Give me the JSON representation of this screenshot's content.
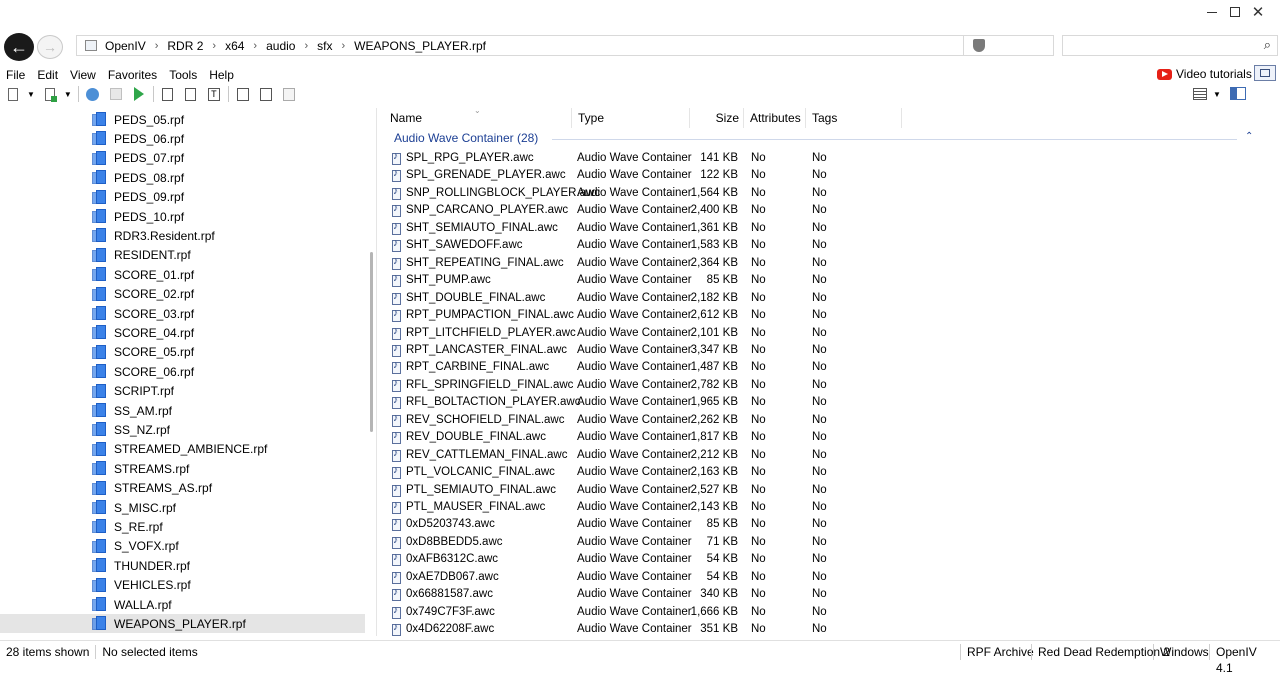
{
  "breadcrumb": [
    "OpenIV",
    "RDR 2",
    "x64",
    "audio",
    "sfx",
    "WEAPONS_PLAYER.rpf"
  ],
  "menu": [
    "File",
    "Edit",
    "View",
    "Favorites",
    "Tools",
    "Help"
  ],
  "video_tutorials": "Video tutorials",
  "tree": [
    "PEDS_05.rpf",
    "PEDS_06.rpf",
    "PEDS_07.rpf",
    "PEDS_08.rpf",
    "PEDS_09.rpf",
    "PEDS_10.rpf",
    "RDR3.Resident.rpf",
    "RESIDENT.rpf",
    "SCORE_01.rpf",
    "SCORE_02.rpf",
    "SCORE_03.rpf",
    "SCORE_04.rpf",
    "SCORE_05.rpf",
    "SCORE_06.rpf",
    "SCRIPT.rpf",
    "SS_AM.rpf",
    "SS_NZ.rpf",
    "STREAMED_AMBIENCE.rpf",
    "STREAMS.rpf",
    "STREAMS_AS.rpf",
    "S_MISC.rpf",
    "S_RE.rpf",
    "S_VOFX.rpf",
    "THUNDER.rpf",
    "VEHICLES.rpf",
    "WALLA.rpf",
    "WEAPONS_PLAYER.rpf"
  ],
  "columns": {
    "name": "Name",
    "type": "Type",
    "size": "Size",
    "attributes": "Attributes",
    "tags": "Tags"
  },
  "group": "Audio Wave Container (28)",
  "files": [
    {
      "name": "SPL_RPG_PLAYER.awc",
      "type": "Audio Wave Container",
      "size": "141 KB",
      "attr": "No",
      "tags": "No"
    },
    {
      "name": "SPL_GRENADE_PLAYER.awc",
      "type": "Audio Wave Container",
      "size": "122 KB",
      "attr": "No",
      "tags": "No"
    },
    {
      "name": "SNP_ROLLINGBLOCK_PLAYER.awc",
      "type": "Audio Wave Container",
      "size": "1,564 KB",
      "attr": "No",
      "tags": "No"
    },
    {
      "name": "SNP_CARCANO_PLAYER.awc",
      "type": "Audio Wave Container",
      "size": "2,400 KB",
      "attr": "No",
      "tags": "No"
    },
    {
      "name": "SHT_SEMIAUTO_FINAL.awc",
      "type": "Audio Wave Container",
      "size": "1,361 KB",
      "attr": "No",
      "tags": "No"
    },
    {
      "name": "SHT_SAWEDOFF.awc",
      "type": "Audio Wave Container",
      "size": "1,583 KB",
      "attr": "No",
      "tags": "No"
    },
    {
      "name": "SHT_REPEATING_FINAL.awc",
      "type": "Audio Wave Container",
      "size": "2,364 KB",
      "attr": "No",
      "tags": "No"
    },
    {
      "name": "SHT_PUMP.awc",
      "type": "Audio Wave Container",
      "size": "85 KB",
      "attr": "No",
      "tags": "No"
    },
    {
      "name": "SHT_DOUBLE_FINAL.awc",
      "type": "Audio Wave Container",
      "size": "2,182 KB",
      "attr": "No",
      "tags": "No"
    },
    {
      "name": "RPT_PUMPACTION_FINAL.awc",
      "type": "Audio Wave Container",
      "size": "2,612 KB",
      "attr": "No",
      "tags": "No"
    },
    {
      "name": "RPT_LITCHFIELD_PLAYER.awc",
      "type": "Audio Wave Container",
      "size": "2,101 KB",
      "attr": "No",
      "tags": "No"
    },
    {
      "name": "RPT_LANCASTER_FINAL.awc",
      "type": "Audio Wave Container",
      "size": "3,347 KB",
      "attr": "No",
      "tags": "No"
    },
    {
      "name": "RPT_CARBINE_FINAL.awc",
      "type": "Audio Wave Container",
      "size": "1,487 KB",
      "attr": "No",
      "tags": "No"
    },
    {
      "name": "RFL_SPRINGFIELD_FINAL.awc",
      "type": "Audio Wave Container",
      "size": "2,782 KB",
      "attr": "No",
      "tags": "No"
    },
    {
      "name": "RFL_BOLTACTION_PLAYER.awc",
      "type": "Audio Wave Container",
      "size": "1,965 KB",
      "attr": "No",
      "tags": "No"
    },
    {
      "name": "REV_SCHOFIELD_FINAL.awc",
      "type": "Audio Wave Container",
      "size": "2,262 KB",
      "attr": "No",
      "tags": "No"
    },
    {
      "name": "REV_DOUBLE_FINAL.awc",
      "type": "Audio Wave Container",
      "size": "1,817 KB",
      "attr": "No",
      "tags": "No"
    },
    {
      "name": "REV_CATTLEMAN_FINAL.awc",
      "type": "Audio Wave Container",
      "size": "2,212 KB",
      "attr": "No",
      "tags": "No"
    },
    {
      "name": "PTL_VOLCANIC_FINAL.awc",
      "type": "Audio Wave Container",
      "size": "2,163 KB",
      "attr": "No",
      "tags": "No"
    },
    {
      "name": "PTL_SEMIAUTO_FINAL.awc",
      "type": "Audio Wave Container",
      "size": "2,527 KB",
      "attr": "No",
      "tags": "No"
    },
    {
      "name": "PTL_MAUSER_FINAL.awc",
      "type": "Audio Wave Container",
      "size": "2,143 KB",
      "attr": "No",
      "tags": "No"
    },
    {
      "name": "0xD5203743.awc",
      "type": "Audio Wave Container",
      "size": "85 KB",
      "attr": "No",
      "tags": "No"
    },
    {
      "name": "0xD8BBEDD5.awc",
      "type": "Audio Wave Container",
      "size": "71 KB",
      "attr": "No",
      "tags": "No"
    },
    {
      "name": "0xAFB6312C.awc",
      "type": "Audio Wave Container",
      "size": "54 KB",
      "attr": "No",
      "tags": "No"
    },
    {
      "name": "0xAE7DB067.awc",
      "type": "Audio Wave Container",
      "size": "54 KB",
      "attr": "No",
      "tags": "No"
    },
    {
      "name": "0x66881587.awc",
      "type": "Audio Wave Container",
      "size": "340 KB",
      "attr": "No",
      "tags": "No"
    },
    {
      "name": "0x749C7F3F.awc",
      "type": "Audio Wave Container",
      "size": "1,666 KB",
      "attr": "No",
      "tags": "No"
    },
    {
      "name": "0x4D62208F.awc",
      "type": "Audio Wave Container",
      "size": "351 KB",
      "attr": "No",
      "tags": "No"
    }
  ],
  "status": {
    "items_shown": "28 items shown",
    "selection": "No selected items",
    "archive": "RPF Archive",
    "game": "Red Dead Redemption 2",
    "platform": "Windows",
    "version": "OpenIV 4.1"
  },
  "colors": {
    "accent": "#1c3f94",
    "selection": "#e5e5e5",
    "rpf_icon": "#3b82e8",
    "youtube": "#e62117"
  }
}
